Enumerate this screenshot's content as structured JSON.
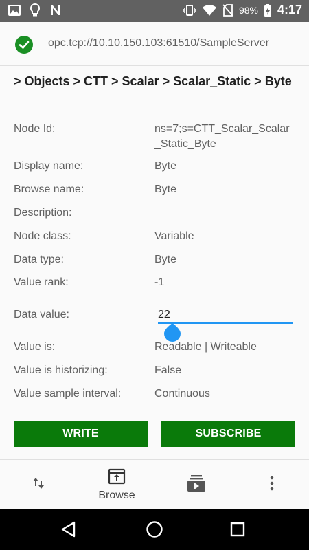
{
  "status_bar": {
    "icons_left": [
      "image-icon",
      "lightbulb-icon",
      "n-notification-icon"
    ],
    "icons_right": [
      "vibrate-icon",
      "wifi-icon",
      "no-sim-icon",
      "battery-charging-icon"
    ],
    "battery": "98%",
    "time": "4:17"
  },
  "server": {
    "status_icon": "check-circle-icon",
    "status_color": "#1a8f24",
    "url": "opc.tcp://10.10.150.103:61510/SampleServer"
  },
  "breadcrumb": "> Objects > CTT > Scalar > Scalar_Static > Byte",
  "properties": [
    {
      "label": "Node Id:",
      "value": "ns=7;s=CTT_Scalar_Scalar_Static_Byte"
    },
    {
      "label": "Display name:",
      "value": "Byte"
    },
    {
      "label": "Browse name:",
      "value": "Byte"
    },
    {
      "label": "Description:",
      "value": ""
    },
    {
      "label": "Node class:",
      "value": "Variable"
    },
    {
      "label": "Data type:",
      "value": "Byte"
    },
    {
      "label": "Value rank:",
      "value": "-1"
    }
  ],
  "data_value": {
    "label": "Data value:",
    "value": "22"
  },
  "properties_after": [
    {
      "label": "Value is:",
      "value": "Readable | Writeable"
    },
    {
      "label": "Value is historizing:",
      "value": "False"
    },
    {
      "label": "Value sample interval:",
      "value": "Continuous"
    }
  ],
  "buttons": {
    "write": "WRITE",
    "subscribe": "SUBSCRIBE",
    "color": "#0a7a0a"
  },
  "bottom_nav": {
    "items": [
      {
        "icon": "swap-vertical-icon",
        "label": ""
      },
      {
        "icon": "browse-icon",
        "label": "Browse"
      },
      {
        "icon": "subscriptions-icon",
        "label": ""
      },
      {
        "icon": "more-vert-icon",
        "label": ""
      }
    ]
  },
  "android_nav": [
    "back-icon",
    "home-icon",
    "recents-icon"
  ],
  "accent_color": "#2196f3"
}
